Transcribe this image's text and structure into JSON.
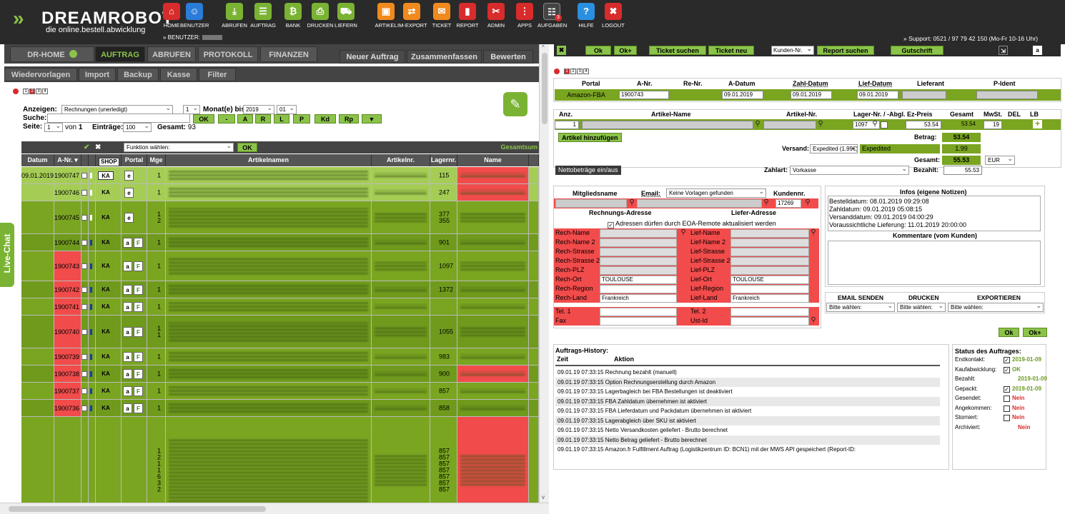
{
  "header": {
    "logo_main": "DREAMROBOT",
    "logo_tag": "die online.bestell.abwicklung",
    "user_label": "» BENUTZER:",
    "support": "» Support: 0521 / 97 79 42 150 (Mo-Fr 10-16 Uhr)",
    "nav": [
      {
        "label": "HOME",
        "icon": "house-icon",
        "color": "red"
      },
      {
        "label": "BENUTZER",
        "icon": "user-icon",
        "color": "blue"
      },
      {
        "label": "ABRUFEN",
        "icon": "download-icon",
        "color": "green"
      },
      {
        "label": "AUFTRAG",
        "icon": "order-icon",
        "color": "green"
      },
      {
        "label": "BANK",
        "icon": "bank-icon",
        "color": "green"
      },
      {
        "label": "DRUCKEN",
        "icon": "printer-icon",
        "color": "green"
      },
      {
        "label": "LIEFERN",
        "icon": "truck-icon",
        "color": "green"
      },
      {
        "label": "ARTIKEL",
        "icon": "box-icon",
        "color": "orange"
      },
      {
        "label": "IM-EXPORT",
        "icon": "im-export-icon",
        "color": "orange"
      },
      {
        "label": "TICKET",
        "icon": "envelope-icon",
        "color": "orange"
      },
      {
        "label": "REPORT",
        "icon": "bar-chart-icon",
        "color": "red"
      },
      {
        "label": "ADMIN",
        "icon": "tools-icon",
        "color": "red"
      },
      {
        "label": "APPS",
        "icon": "grid-icon",
        "color": "red"
      },
      {
        "label": "AUFGABEN",
        "icon": "tasks-icon",
        "color": "dark",
        "badge": "3"
      },
      {
        "label": "HILFE",
        "icon": "help-icon",
        "color": "lblue"
      },
      {
        "label": "LOGOUT",
        "icon": "logout-icon",
        "color": "red"
      }
    ]
  },
  "left": {
    "tabs": [
      "DR-HOME",
      "AUFTRAG",
      "ABRUFEN",
      "PROTOKOLL",
      "FINANZEN"
    ],
    "tabs_right": [
      "Neuer Auftrag",
      "Zusammenfassen",
      "Bewerten"
    ],
    "subtabs": [
      "Wiedervorlagen",
      "Import",
      "Backup",
      "Kasse",
      "Filter"
    ],
    "pages": [
      "1",
      "2",
      "3",
      "4"
    ],
    "filter": {
      "anzeigen_label": "Anzeigen:",
      "anzeigen_value": "Rechnungen (unerledigt)",
      "monat_count": "1",
      "monat_label": "Monat(e) bis",
      "year": "2019",
      "month": "01",
      "suche_label": "Suche:",
      "seite_label": "Seite:",
      "seite_value": "1",
      "von_label": "von",
      "von_value": "1",
      "eintraege_label": "Einträge:",
      "eintraege_value": "100",
      "gesamt_label": "Gesamt:",
      "gesamt_value": "93",
      "buttons": [
        "OK",
        "-",
        "A",
        "R",
        "L",
        "P",
        "Kd",
        "Rp",
        "▼"
      ]
    },
    "gridbar": {
      "funktion": "Funktion wählen:",
      "ok": "OK",
      "gesamtsumme": "Gesamtsum"
    },
    "columns": [
      "Datum",
      "A-Nr. ▾",
      "",
      "",
      "SHOP",
      "Portal",
      "Mge",
      "Artikelnamen",
      "Artikelnr.",
      "Lagernr.",
      "Name"
    ],
    "rows": [
      {
        "date": "09.01.2019",
        "anr": "1900747",
        "shop": "KA",
        "framed": true,
        "portal": "ebay",
        "mge": "1",
        "lager": "115",
        "name_red": true,
        "anr_red": false,
        "light": true
      },
      {
        "date": "",
        "anr": "1900746",
        "shop": "KA",
        "framed": false,
        "portal": "ebay",
        "mge": "1",
        "lager": "247",
        "name_red": true,
        "anr_red": false,
        "light": true
      },
      {
        "date": "",
        "anr": "1900745",
        "shop": "KA",
        "framed": false,
        "portal": "ebay",
        "mge": "1\n2",
        "lager": "377\n355",
        "name_red": false,
        "anr_red": false,
        "light": false
      },
      {
        "date": "",
        "anr": "1900744",
        "shop": "KA",
        "framed": false,
        "portal": "amazon",
        "mge": "1",
        "lager": "901",
        "name_red": false,
        "anr_red": false,
        "light": false
      },
      {
        "date": "",
        "anr": "1900743",
        "shop": "KA",
        "framed": false,
        "portal": "amazon",
        "mge": "1",
        "lager": "1097",
        "name_red": false,
        "anr_red": true,
        "light": false
      },
      {
        "date": "",
        "anr": "1900742",
        "shop": "KA",
        "framed": false,
        "portal": "amazon",
        "mge": "1",
        "lager": "1372",
        "name_red": false,
        "anr_red": true,
        "light": false
      },
      {
        "date": "",
        "anr": "1900741",
        "shop": "KA",
        "framed": false,
        "portal": "amazon",
        "mge": "1",
        "lager": "",
        "name_red": false,
        "anr_red": true,
        "light": false
      },
      {
        "date": "",
        "anr": "1900740",
        "shop": "KA",
        "framed": false,
        "portal": "amazon",
        "mge": "1\n1",
        "lager": "1055",
        "name_red": false,
        "anr_red": true,
        "light": false
      },
      {
        "date": "",
        "anr": "1900739",
        "shop": "KA",
        "framed": false,
        "portal": "amazon",
        "mge": "1",
        "lager": "983",
        "name_red": false,
        "anr_red": true,
        "light": false
      },
      {
        "date": "",
        "anr": "1900738",
        "shop": "KA",
        "framed": false,
        "portal": "amazon",
        "mge": "1",
        "lager": "900",
        "name_red": true,
        "anr_red": true,
        "light": false
      },
      {
        "date": "",
        "anr": "1900737",
        "shop": "KA",
        "framed": false,
        "portal": "amazon",
        "mge": "1",
        "lager": "857",
        "name_red": false,
        "anr_red": true,
        "light": false
      },
      {
        "date": "",
        "anr": "1900736",
        "shop": "KA",
        "framed": false,
        "portal": "amazon",
        "mge": "1",
        "lager": "858",
        "name_red": false,
        "anr_red": true,
        "light": false
      },
      {
        "date": "",
        "anr": "",
        "shop": "",
        "framed": false,
        "portal": "",
        "mge": "1\n2\n1\n1\n6\n3\n2",
        "lager": "857\n857\n857\n857\n857\n857\n857",
        "name_red": true,
        "anr_red": false,
        "light": false
      }
    ],
    "live_chat": "Live-Chat"
  },
  "right": {
    "toolbar": {
      "ok": "Ok",
      "okplus": "Ok+",
      "ticket_suchen": "Ticket suchen",
      "ticket_neu": "Ticket neu",
      "kunden_sel": "Kunden-Nr.",
      "report": "Report suchen",
      "gutschrift": "Gutschrift"
    },
    "order_head": [
      "Portal",
      "A-Nr.",
      "Re-Nr.",
      "A-Datum",
      "Zahl-Datum",
      "Lief-Datum",
      "Lieferant",
      "P-Ident"
    ],
    "order_row": {
      "portal": "Amazon-FBA",
      "anr": "1900743",
      "adatum": "09.01.2019",
      "zdatum": "09.01.2019",
      "ldatum": "09.01.2019"
    },
    "art_head": [
      "Anz.",
      "Artikel-Name",
      "Artikel-Nr.",
      "Lager-Nr. / -Abgl.",
      "Ez-Preis",
      "Gesamt",
      "MwSt.",
      "DEL",
      "LB"
    ],
    "art_row": {
      "anz": "1",
      "lager": "1097",
      "ez": "53.54",
      "gesamt": "53.54",
      "mwst": "19"
    },
    "artikel_hinzu": "Artikel hinzufügen",
    "betrag_label": "Betrag:",
    "betrag_value": "53.54",
    "versand_label": "Versand:",
    "versand_sel": "Expedited (1.99€)",
    "versand_text": "Expedited",
    "versand_value": "1.99",
    "gesamt_label": "Gesamt:",
    "gesamt_value": "55.53",
    "currency": "EUR",
    "netto_btn": "Nettobeträge ein/aus",
    "zahlart_label": "Zahlart:",
    "zahlart_value": "Vorkasse",
    "bezahlt_label": "Bezahlt:",
    "bezahlt_value": "55.53",
    "mitglied_label": "Mitgliedsname",
    "email_label": "Email:",
    "email_sel": "Keine Vorlagen gefunden",
    "kundennr_label": "Kundennr.",
    "kundennr_value": "17269",
    "rech_addr_title": "Rechnungs-Adresse",
    "lief_addr_title": "Liefer-Adresse",
    "eoa_text": "Adressen dürfen durch EOA-Remote aktualisiert werden",
    "rech_fields": [
      {
        "label": "Rech-Name",
        "value": ""
      },
      {
        "label": "Rech-Name 2",
        "value": ""
      },
      {
        "label": "Rech-Strasse",
        "value": ""
      },
      {
        "label": "Rech-Strasse 2",
        "value": ""
      },
      {
        "label": "Rech-PLZ",
        "value": ""
      },
      {
        "label": "Rech-Ort",
        "value": "TOULOUSE"
      },
      {
        "label": "Rech-Region",
        "value": ""
      },
      {
        "label": "Rech-Land",
        "value": "Frankreich"
      },
      {
        "label": "Tel. 1",
        "value": ""
      },
      {
        "label": "Fax",
        "value": ""
      }
    ],
    "lief_fields": [
      {
        "label": "Lief-Name",
        "value": ""
      },
      {
        "label": "Lief-Name 2",
        "value": ""
      },
      {
        "label": "Lief-Strasse",
        "value": ""
      },
      {
        "label": "Lief-Strasse 2",
        "value": ""
      },
      {
        "label": "Lief-PLZ",
        "value": ""
      },
      {
        "label": "Lief-Ort",
        "value": "TOULOUSE"
      },
      {
        "label": "Lief-Region",
        "value": ""
      },
      {
        "label": "Lief-Land",
        "value": "Frankreich"
      },
      {
        "label": "Tel. 2",
        "value": ""
      },
      {
        "label": "Ust-Id",
        "value": ""
      }
    ],
    "infos_title": "Infos (eigene Notizen)",
    "infos_lines": [
      "Bestelldatum: 08.01.2019 09:29:08",
      "Zahldatum:  09.01.2019 05:08:15",
      "Versanddatum: 09.01.2019 04:00:29",
      "Voraussichtliche Lieferung: 11.01.2019 20:00:00"
    ],
    "komm_title": "Kommentare (vom Kunden)",
    "actions": [
      "EMAIL SENDEN",
      "DRUCKEN",
      "EXPORTIEREN"
    ],
    "action_sel": "Bitte wählen:",
    "ok": "Ok",
    "okplus": "Ok+",
    "history_title": "Auftrags-History:",
    "history_cols": [
      "Zeit",
      "Aktion"
    ],
    "history": [
      "09.01.19 07:33:15  Rechnung bezahlt (manuell)",
      "09.01.19 07:33:15  Option Rechnungserstellung durch Amazon",
      "09.01.19 07:33:15  Lagerbagleich bei FBA Bestellungen ist deaktiviert",
      "09.01.19 07:33:15  FBA Zahldatum übernehmen ist aktiviert",
      "09.01.19 07:33:15  FBA Lieferdatum und Packdatum übernehmen ist aktiviert",
      "09.01.19 07:33:15  Lagerabgleich über SKU ist aktiviert",
      "09.01.19 07:33:15  Netto Versandkosten geliefert - Brutto berechnet",
      "09.01.19 07:33:15  Netto Betrag geliefert - Brutto berechnet",
      "09.01.19 07:33:15  Amazon.fr Fulfillment Auftrag (Logistikzentrum ID: BCN1) mit der MWS API gespeichert (Report-ID:"
    ],
    "status_title": "Status des Auftrages:",
    "status": [
      {
        "label": "Erstkontakt:",
        "value": "2019-01-09",
        "checked": true,
        "color": "green"
      },
      {
        "label": "Kaufabwicklung:",
        "value": "OK",
        "checked": true,
        "color": "green"
      },
      {
        "label": "Bezahlt:",
        "value": "2019-01-09",
        "checked": false,
        "nobox": true,
        "color": "green"
      },
      {
        "label": "Gepackt:",
        "value": "2019-01-09",
        "checked": true,
        "color": "green"
      },
      {
        "label": "Gesendet:",
        "value": "Nein",
        "checked": false,
        "color": "red"
      },
      {
        "label": "Angekommen:",
        "value": "Nein",
        "checked": false,
        "color": "red"
      },
      {
        "label": "Storniert:",
        "value": "Nein",
        "checked": false,
        "color": "red"
      },
      {
        "label": "Archiviert:",
        "value": "Nein",
        "checked": false,
        "nobox": true,
        "color": "red"
      }
    ]
  },
  "colors": {
    "brand_green": "#8bc34a",
    "row_green": "#7aa520",
    "row_light": "#a5cd55",
    "alert_red": "#f24b4b",
    "header_dark": "#2a2a2a"
  }
}
